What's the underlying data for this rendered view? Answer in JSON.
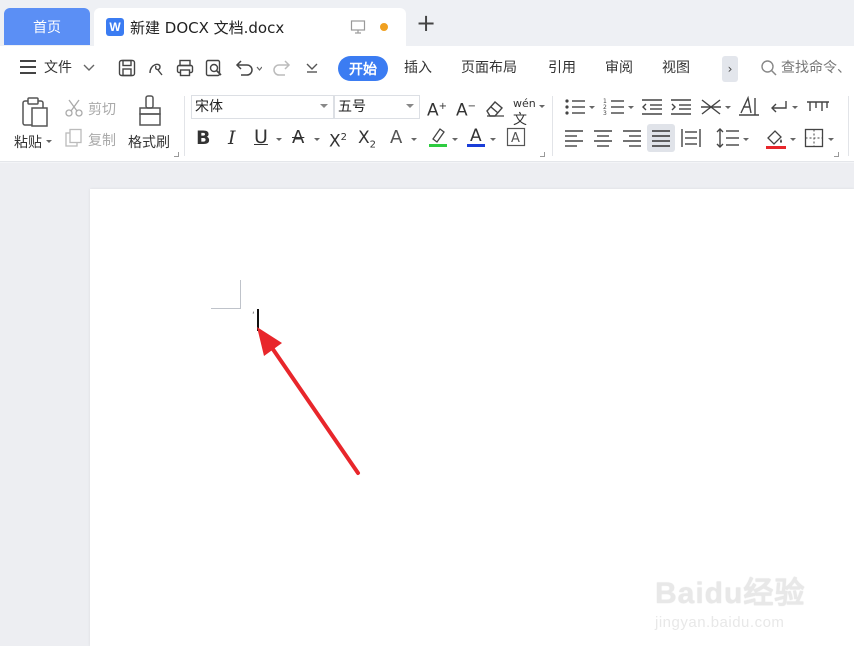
{
  "tabs": {
    "home": "首页",
    "document": "新建 DOCX 文档.docx",
    "w_logo": "W"
  },
  "menubar": {
    "file": "文件",
    "items": [
      "开始",
      "插入",
      "页面布局",
      "引用",
      "审阅",
      "视图"
    ],
    "search_placeholder": "查找命令、"
  },
  "ribbon": {
    "paste": "粘贴",
    "cut": "剪切",
    "copy": "复制",
    "format_painter": "格式刷",
    "font_name": "宋体",
    "font_size": "五号",
    "phonetic": "wén"
  },
  "colors": {
    "accent": "#3b7cf2",
    "home_tab": "#5b8ff5",
    "highlight": "#2ecc40",
    "font_color": "#1a3dd8",
    "arrow": "#e8262b"
  },
  "watermark": {
    "brand": "Baidu经验",
    "url": "jingyan.baidu.com"
  }
}
